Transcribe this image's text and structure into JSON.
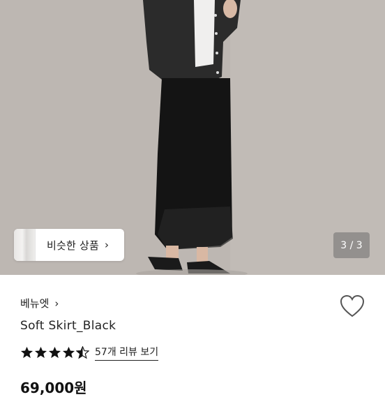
{
  "gallery": {
    "similar_label": "비슷한 상품",
    "similar_chevron": "›",
    "page_counter": "3 / 3"
  },
  "product": {
    "shop_name": "베뉴엣",
    "shop_chevron": "›",
    "name": "Soft Skirt_Black",
    "rating": 4.5,
    "review_link": "57개 리뷰 보기",
    "price": "69,000원"
  },
  "icons": {
    "wishlist": "heart-icon",
    "star": "star-icon",
    "half_star": "star-half-icon"
  },
  "colors": {
    "text": "#222222",
    "star": "#111111",
    "counter_bg": "#6e6e6e"
  }
}
